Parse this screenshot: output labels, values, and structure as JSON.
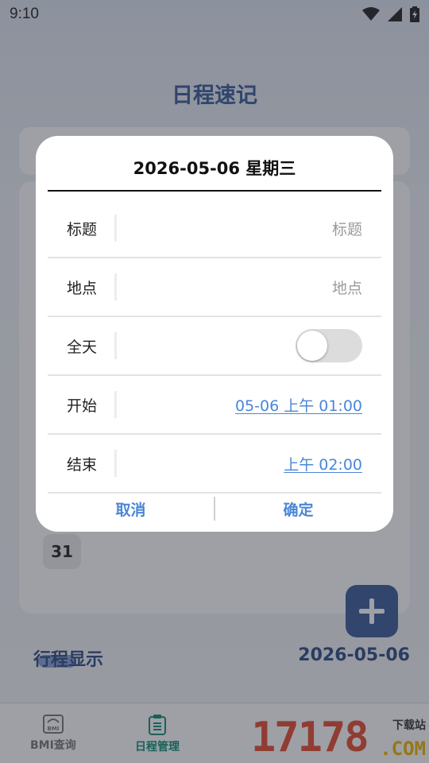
{
  "status_bar": {
    "time": "9:10"
  },
  "app": {
    "title": "日程速记",
    "calendar_visible_day": "31",
    "itinerary_label": "行程显示",
    "selected_date": "2026-05-06",
    "fab_icon": "plus-icon"
  },
  "bottom_nav": {
    "items": [
      {
        "label": "BMI查询",
        "icon": "bmi-scale-icon",
        "active": false
      },
      {
        "label": "日程管理",
        "icon": "clipboard-icon",
        "active": true
      }
    ]
  },
  "watermark": {
    "digits": "17178",
    "sub": "下载站",
    "domain": ".COM"
  },
  "dialog": {
    "title": "2026-05-06 星期三",
    "rows": [
      {
        "label": "标题",
        "placeholder": "标题"
      },
      {
        "label": "地点",
        "placeholder": "地点"
      },
      {
        "label": "全天",
        "toggle_on": false
      },
      {
        "label": "开始",
        "value": "05-06 上午 01:00"
      },
      {
        "label": "结束",
        "value": "上午 02:00"
      }
    ],
    "cancel_label": "取消",
    "confirm_label": "确定"
  },
  "colors": {
    "accent": "#4a86d8",
    "brand": "#3a5a9a",
    "nav_active": "#0d8c76"
  }
}
